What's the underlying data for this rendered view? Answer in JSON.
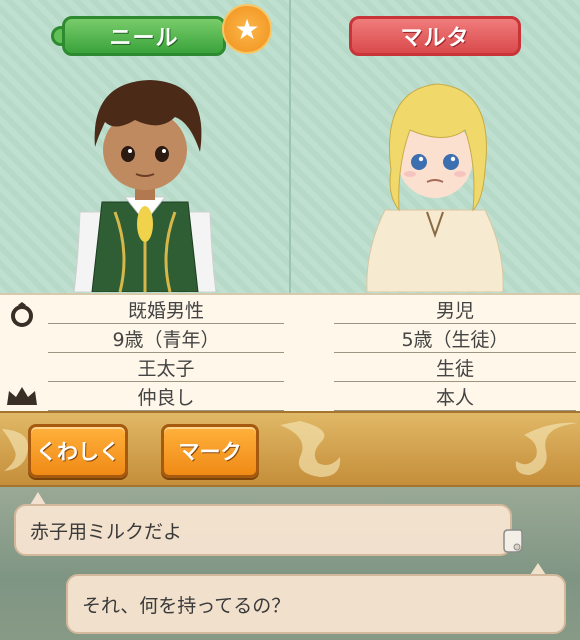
{
  "characters": {
    "left": {
      "name": "ニール",
      "status": "既婚男性",
      "age": "9歳（青年）",
      "role": "王太子",
      "relation": "仲良し",
      "tag_color": "#3aa33b"
    },
    "right": {
      "name": "マルタ",
      "status": "男児",
      "age": "5歳（生徒）",
      "role": "生徒",
      "relation": "本人",
      "tag_color": "#da4a4c"
    }
  },
  "icons": {
    "favorite": "star-icon",
    "marriage": "ring-icon",
    "rank": "crown-icon",
    "log": "scroll-icon"
  },
  "badge": {
    "star": "★"
  },
  "actions": {
    "detail_label": "くわしく",
    "mark_label": "マーク"
  },
  "dialogue": {
    "line_1": "赤子用ミルクだよ",
    "line_2": "それ、何を持ってるの？"
  }
}
